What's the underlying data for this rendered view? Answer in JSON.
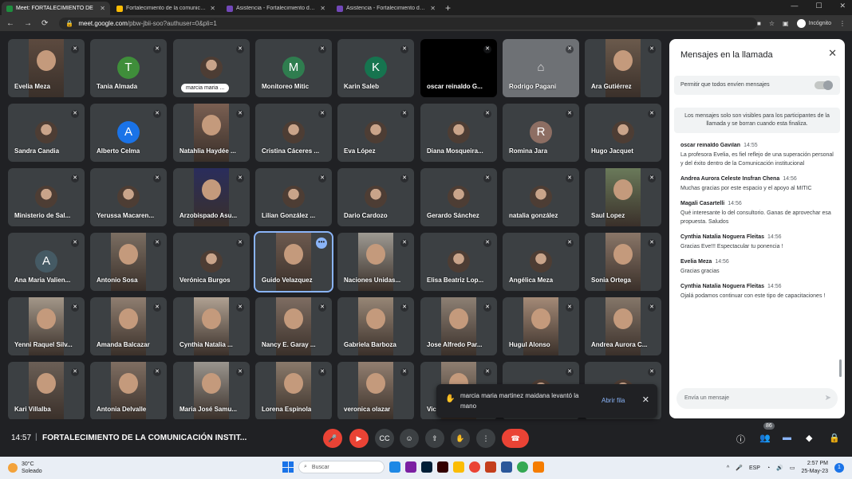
{
  "browser": {
    "tabs": [
      {
        "title": "Meet: FORTALECIMIENTO DE",
        "active": true,
        "fav": "#1e8e3e"
      },
      {
        "title": "Fortalecimiento de la comunicación",
        "active": false,
        "fav": "#fbbc04"
      },
      {
        "title": "Asistencia - Fortalecimiento de la",
        "active": false,
        "fav": "#7248b9"
      },
      {
        "title": "Asistencia - Fortalecimiento de la",
        "active": false,
        "fav": "#7248b9"
      }
    ],
    "url_host": "meet.google.com",
    "url_path": "/pbw-jbii-soo?authuser=0&pli=1",
    "profile": "Incógnito"
  },
  "tiles": [
    {
      "name": "Evelia Meza",
      "kind": "video",
      "bg": "#5c4a3f"
    },
    {
      "name": "Tania Almada",
      "kind": "avatar",
      "letter": "T",
      "color": "#3f8e3a"
    },
    {
      "name": "marcia maria ...",
      "kind": "photo",
      "pill": true
    },
    {
      "name": "Monitoreo Mitic",
      "kind": "avatar",
      "letter": "M",
      "color": "#2f7d4f"
    },
    {
      "name": "Karin Saleb",
      "kind": "avatar",
      "letter": "K",
      "color": "#16744f"
    },
    {
      "name": "oscar reinaldo G...",
      "kind": "black"
    },
    {
      "name": "Rodrigo Pagani",
      "kind": "grey"
    },
    {
      "name": "Ara Gutiérrez",
      "kind": "video",
      "bg": "#6b5a4c"
    },
    {
      "name": "Sandra Candia",
      "kind": "photo"
    },
    {
      "name": "Alberto Celma",
      "kind": "avatar",
      "letter": "A",
      "color": "#1a73e8"
    },
    {
      "name": "Natahlia Haydée ...",
      "kind": "video",
      "bg": "#7a5f52"
    },
    {
      "name": "Cristina Cáceres ...",
      "kind": "photo"
    },
    {
      "name": "Eva López",
      "kind": "photo"
    },
    {
      "name": "Diana Mosqueira...",
      "kind": "photo"
    },
    {
      "name": "Romina Jara",
      "kind": "avatar",
      "letter": "R",
      "color": "#8d6e63"
    },
    {
      "name": "Hugo Jacquet",
      "kind": "photo"
    },
    {
      "name": "Ministerio de Sal...",
      "kind": "photo"
    },
    {
      "name": "Yerussa Macaren...",
      "kind": "photo"
    },
    {
      "name": "Arzobispado Asu...",
      "kind": "video",
      "bg": "#2a2d5c"
    },
    {
      "name": "Lilian González ...",
      "kind": "photo"
    },
    {
      "name": "Dario Cardozo",
      "kind": "photo"
    },
    {
      "name": "Gerardo Sánchez",
      "kind": "photo"
    },
    {
      "name": "natalia gonzález",
      "kind": "photo"
    },
    {
      "name": "Saul Lopez",
      "kind": "video",
      "bg": "#6a7a5a"
    },
    {
      "name": "Ana Maria Valien...",
      "kind": "avatar",
      "letter": "A",
      "color": "#455a64"
    },
    {
      "name": "Antonio Sosa",
      "kind": "video",
      "bg": "#7b6e62"
    },
    {
      "name": "Verónica Burgos",
      "kind": "photo"
    },
    {
      "name": "Guido Velazquez",
      "kind": "video",
      "bg": "#6d5a4f",
      "speaking": true
    },
    {
      "name": "Naciones Unidas...",
      "kind": "video",
      "bg": "#9e9a92"
    },
    {
      "name": "Elisa Beatriz Lop...",
      "kind": "photo"
    },
    {
      "name": "Angélica Meza",
      "kind": "photo"
    },
    {
      "name": "Sonia Ortega",
      "kind": "video",
      "bg": "#8a7668"
    },
    {
      "name": "Yenni Raquel Silv...",
      "kind": "video",
      "bg": "#a39789"
    },
    {
      "name": "Amanda Balcazar",
      "kind": "video",
      "bg": "#8f7e70"
    },
    {
      "name": "Cynthia Natalia ...",
      "kind": "video",
      "bg": "#b0a192"
    },
    {
      "name": "Nancy E. Garay ...",
      "kind": "video",
      "bg": "#7e6d62"
    },
    {
      "name": "Gabriela Barboza",
      "kind": "video",
      "bg": "#978676"
    },
    {
      "name": "Jose Alfredo Par...",
      "kind": "video",
      "bg": "#8d8074"
    },
    {
      "name": "Hugul Alonso",
      "kind": "video",
      "bg": "#a48a77"
    },
    {
      "name": "Andrea Aurora C...",
      "kind": "video",
      "bg": "#857669"
    },
    {
      "name": "Kari Villalba",
      "kind": "video",
      "bg": "#6b5f56"
    },
    {
      "name": "Antonia Delvalle",
      "kind": "video",
      "bg": "#7f6e62"
    },
    {
      "name": "Maria José Samu...",
      "kind": "video",
      "bg": "#9a958e"
    },
    {
      "name": "Lorena Espinola",
      "kind": "video",
      "bg": "#8a7a6b"
    },
    {
      "name": "veronica olazar",
      "kind": "video",
      "bg": "#927f70"
    },
    {
      "name": "Vic...",
      "kind": "video",
      "bg": "#8f7f71"
    },
    {
      "name": "",
      "kind": "photo"
    },
    {
      "name": "",
      "kind": "photo"
    }
  ],
  "panel": {
    "title": "Mensajes en la llamada",
    "permission": "Permitir que todos envíen mensajes",
    "info": "Los mensajes solo son visibles para los participantes de la llamada y se borran cuando esta finaliza.",
    "messages": [
      {
        "author": "oscar reinaldo Gavilan",
        "time": "14:55",
        "text": "La profesora Evelia, es fiel reflejo de una superación personal y del éxito dentro de la Comunicación institucional"
      },
      {
        "author": "Andrea Aurora Celeste Insfran Chena",
        "time": "14:56",
        "text": "Muchas gracias por este espacio y el apoyo al MITIC"
      },
      {
        "author": "Magali Casartelli",
        "time": "14:56",
        "text": "Qué interesante lo del consultorio. Ganas de aprovechar esa propuesta. Saludos"
      },
      {
        "author": "Cynthia Natalia Noguera Fleitas",
        "time": "14:56",
        "text": "Gracias Eve!!! Espectacular tu ponencia !"
      },
      {
        "author": "Evelia Meza",
        "time": "14:56",
        "text": "Gracias gracias"
      },
      {
        "author": "Cynthia Natalia Noguera Fleitas",
        "time": "14:56",
        "text": "Ojalá podamos continuar con este tipo de capacitaciones !"
      }
    ],
    "compose_placeholder": "Envía un mensaje"
  },
  "toast": {
    "text": "marcia maria martinez maidana levantó la mano",
    "action": "Abrir fila"
  },
  "bottom": {
    "time": "14:57",
    "meeting": "FORTALECIMIENTO DE LA COMUNICACIÓN INSTIT...",
    "participants": "86"
  },
  "taskbar": {
    "temp": "30°C",
    "weather": "Soleado",
    "search": "Buscar",
    "lang": "ESP",
    "time": "2:57 PM",
    "date": "25-May-23"
  }
}
